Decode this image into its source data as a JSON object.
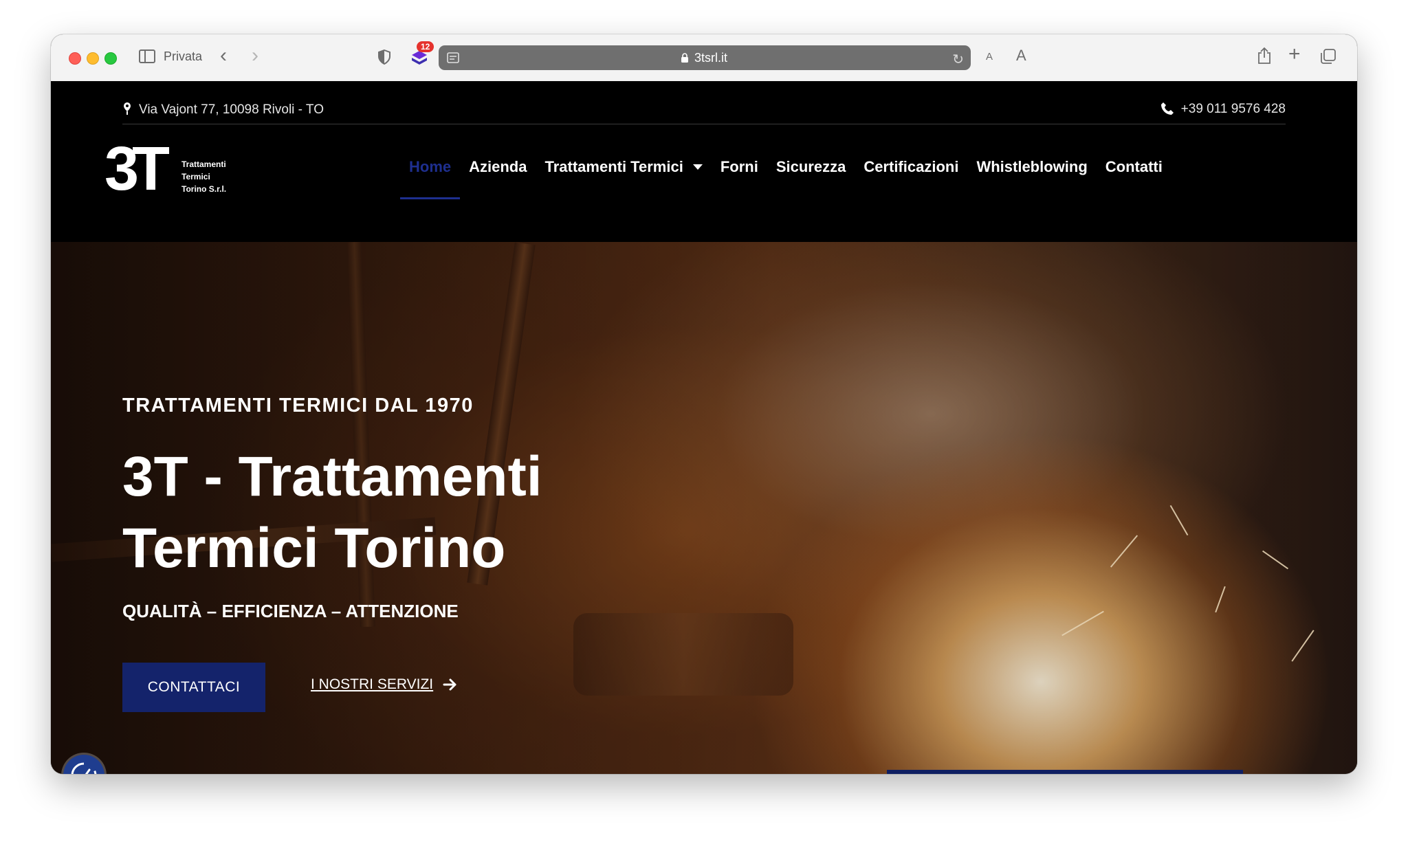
{
  "browser": {
    "private_label": "Privata",
    "url": "3tsrl.it",
    "extension_badge": "12",
    "text_size_small": "A",
    "text_size_large": "A"
  },
  "topbar": {
    "address": "Via Vajont 77, 10098 Rivoli - TO",
    "phone": "+39 011 9576 428"
  },
  "logo": {
    "mark": "3T",
    "line1": "Trattamenti",
    "line2": "Termici",
    "line3": "Torino S.r.l."
  },
  "nav": {
    "items": [
      {
        "label": "Home",
        "active": true
      },
      {
        "label": "Azienda"
      },
      {
        "label": "Trattamenti Termici",
        "has_dropdown": true
      },
      {
        "label": "Forni"
      },
      {
        "label": "Sicurezza"
      },
      {
        "label": "Certificazioni"
      },
      {
        "label": "Whistleblowing"
      },
      {
        "label": "Contatti"
      }
    ]
  },
  "hero": {
    "eyebrow": "TRATTAMENTI TERMICI DAL 1970",
    "headline": "3T - Trattamenti Termici Torino",
    "tagline": "QUALITÀ – EFFICIENZA – ATTENZIONE",
    "primary_cta": "CONTATTACI",
    "secondary_cta": "I NOSTRI SERVIZI"
  },
  "colors": {
    "accent": "#1e2f8f",
    "button": "#14236b",
    "top_bg": "#000000"
  }
}
